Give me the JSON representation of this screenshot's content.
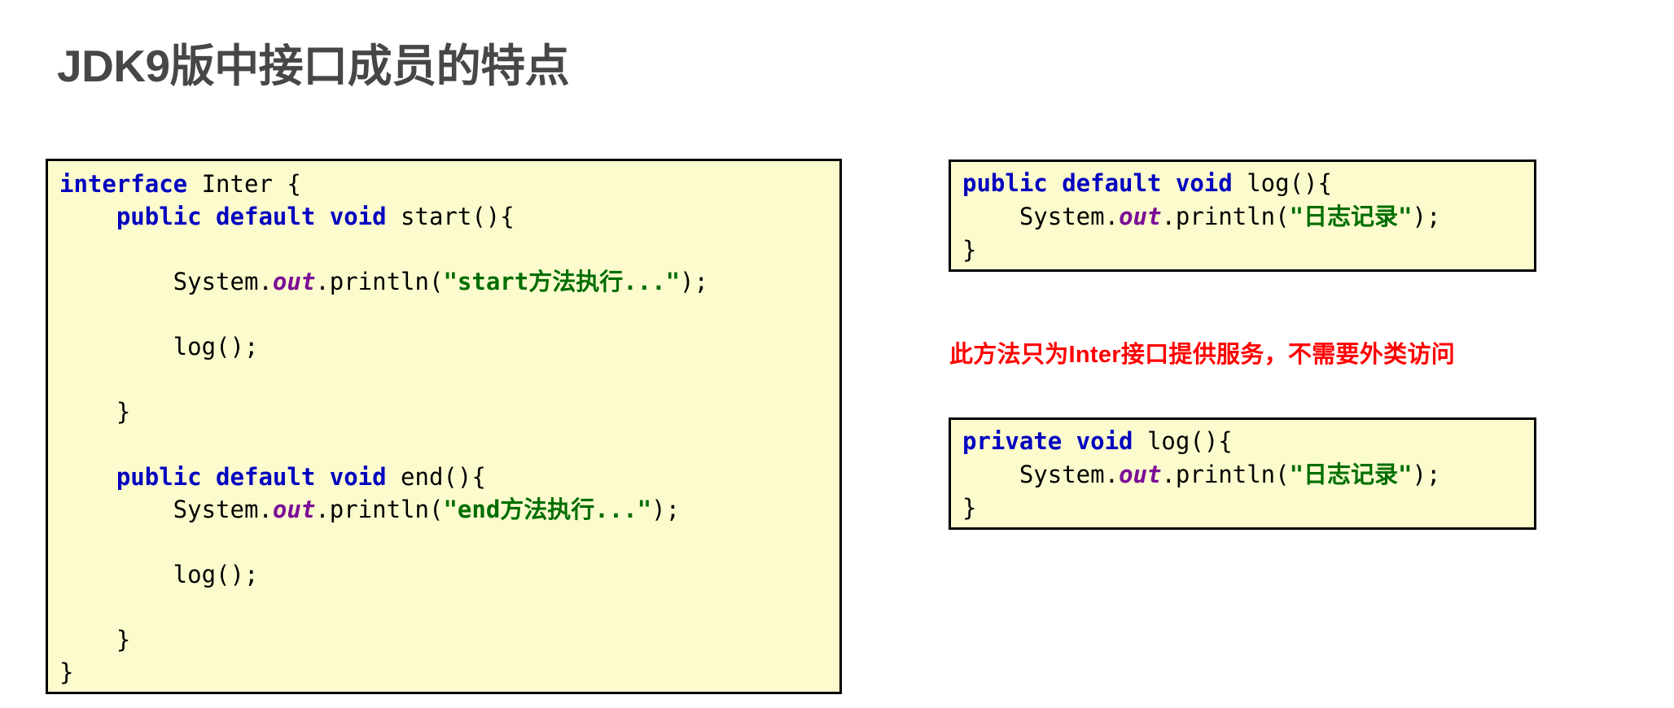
{
  "slide": {
    "title": "JDK9版中接口成员的特点",
    "title_color": "#474747",
    "background_color": "#ffffff"
  },
  "theme": {
    "code_background": "#FCFBCD",
    "code_border": "#000000",
    "keyword_color": "#0000BF",
    "string_color": "#006E00",
    "field_color": "#7B0F96",
    "plain_color": "#000000",
    "annotation_color": "#FF0000"
  },
  "main_code_box": {
    "name": "interface-inter-code",
    "lines": [
      [
        {
          "t": "interface",
          "c": "kw"
        },
        {
          "t": " Inter {",
          "c": "plain"
        }
      ],
      [
        {
          "t": "    ",
          "c": "plain"
        },
        {
          "t": "public default void",
          "c": "kw"
        },
        {
          "t": " start(){",
          "c": "plain"
        }
      ],
      [
        {
          "t": "",
          "c": "plain"
        }
      ],
      [
        {
          "t": "        System.",
          "c": "plain"
        },
        {
          "t": "out",
          "c": "fld"
        },
        {
          "t": ".println(",
          "c": "plain"
        },
        {
          "t": "\"start方法执行...\"",
          "c": "str"
        },
        {
          "t": ");",
          "c": "plain"
        }
      ],
      [
        {
          "t": "",
          "c": "plain"
        }
      ],
      [
        {
          "t": "        log();",
          "c": "plain"
        }
      ],
      [
        {
          "t": "",
          "c": "plain"
        }
      ],
      [
        {
          "t": "    }",
          "c": "plain"
        }
      ],
      [
        {
          "t": "",
          "c": "plain"
        }
      ],
      [
        {
          "t": "    ",
          "c": "plain"
        },
        {
          "t": "public default void",
          "c": "kw"
        },
        {
          "t": " end(){",
          "c": "plain"
        }
      ],
      [
        {
          "t": "        System.",
          "c": "plain"
        },
        {
          "t": "out",
          "c": "fld"
        },
        {
          "t": ".println(",
          "c": "plain"
        },
        {
          "t": "\"end方法执行...\"",
          "c": "str"
        },
        {
          "t": ");",
          "c": "plain"
        }
      ],
      [
        {
          "t": "",
          "c": "plain"
        }
      ],
      [
        {
          "t": "        log();",
          "c": "plain"
        }
      ],
      [
        {
          "t": "",
          "c": "plain"
        }
      ],
      [
        {
          "t": "    }",
          "c": "plain"
        }
      ],
      [
        {
          "t": "}",
          "c": "plain"
        }
      ]
    ]
  },
  "log_default_box": {
    "name": "public-default-log-code",
    "lines": [
      [
        {
          "t": "public default void",
          "c": "kw"
        },
        {
          "t": " log(){",
          "c": "plain"
        }
      ],
      [
        {
          "t": "    System.",
          "c": "plain"
        },
        {
          "t": "out",
          "c": "fld"
        },
        {
          "t": ".println(",
          "c": "plain"
        },
        {
          "t": "\"日志记录\"",
          "c": "str"
        },
        {
          "t": ");",
          "c": "plain"
        }
      ],
      [
        {
          "t": "}",
          "c": "plain"
        }
      ]
    ]
  },
  "log_private_box": {
    "name": "private-log-code",
    "lines": [
      [
        {
          "t": "private void",
          "c": "kw"
        },
        {
          "t": " log(){",
          "c": "plain"
        }
      ],
      [
        {
          "t": "    System.",
          "c": "plain"
        },
        {
          "t": "out",
          "c": "fld"
        },
        {
          "t": ".println(",
          "c": "plain"
        },
        {
          "t": "\"日志记录\"",
          "c": "str"
        },
        {
          "t": ");",
          "c": "plain"
        }
      ],
      [
        {
          "t": "}",
          "c": "plain"
        }
      ]
    ]
  },
  "annotation": {
    "text": "此方法只为Inter接口提供服务，不需要外类访问"
  }
}
